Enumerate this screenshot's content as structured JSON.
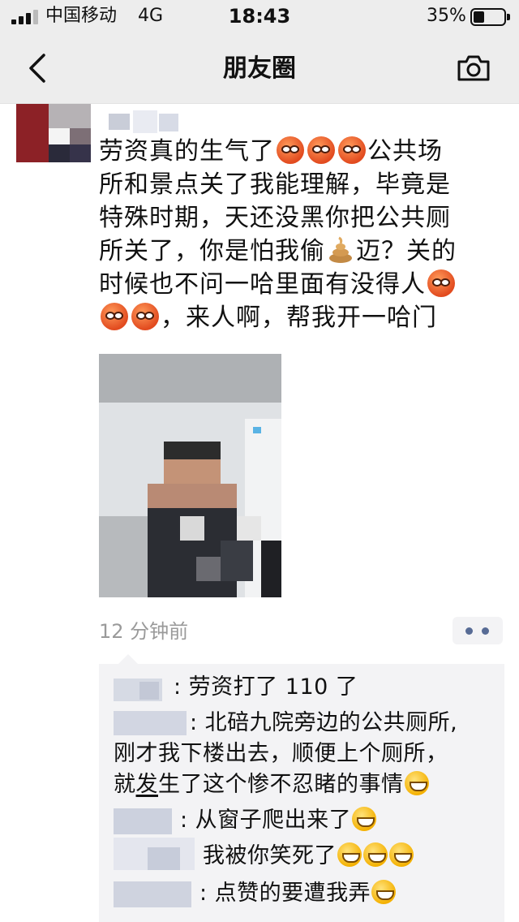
{
  "status_bar": {
    "carrier": "中国移动",
    "network": "4G",
    "time": "18:43",
    "battery_percent": "35%",
    "battery_level": 0.35
  },
  "nav": {
    "back_icon": "chevron-left-icon",
    "title": "朋友圈",
    "camera_icon": "camera-icon"
  },
  "post": {
    "text_lines": [
      "劳资真的生气了",
      "公共场",
      "所和景点关了我能理解，毕竟是",
      "特殊时期，天还没黑你把公共厕",
      "所关了，你是怕我偷",
      "迈？关的",
      "时候也不问一哈里面有没得人",
      "，来人啊，帮我开一哈门"
    ],
    "emoji": {
      "angry": "angry-face-icon",
      "poop": "poop-icon"
    },
    "timestamp": "12 分钟前",
    "more_icon": "more-dots-icon"
  },
  "comments": [
    {
      "text": ": 劳资打了 110 了"
    },
    {
      "text_lines": [
        ": 北碚九院旁边的公共厕所,",
        "刚才我下楼出去，顺便上个厕所，",
        "就",
        "发",
        "生了这个惨不忍睹的事情"
      ]
    },
    {
      "text": ": 从窗子爬出来了"
    },
    {
      "text": "我被你笑死了"
    },
    {
      "text": ": 点赞的要遭我弄"
    }
  ],
  "colors": {
    "bar_bg": "#ededed",
    "link_blue": "#576b95",
    "comment_bg": "#f3f3f5",
    "timestamp_gray": "#9a9a9a"
  }
}
